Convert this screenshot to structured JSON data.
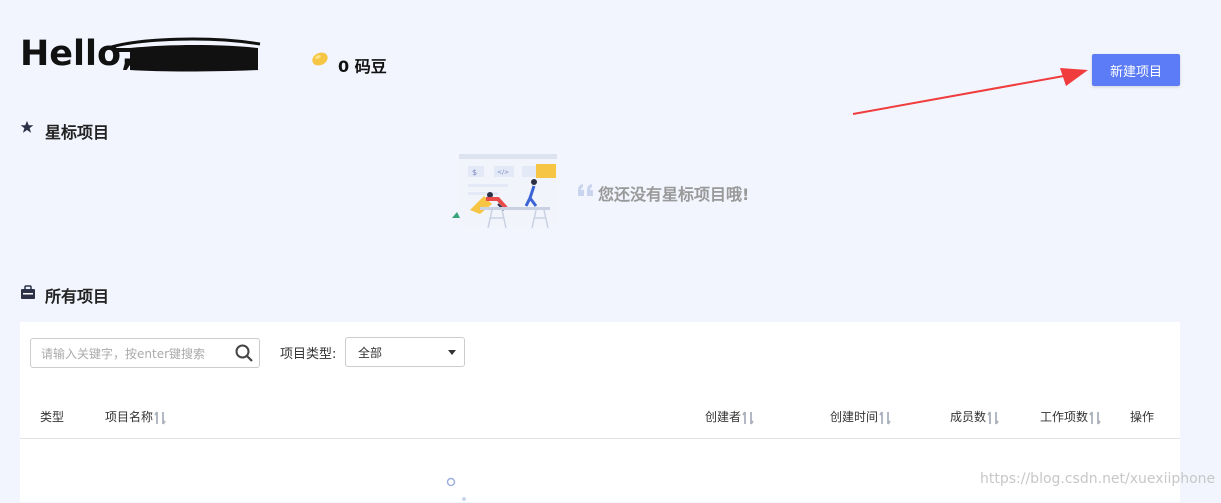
{
  "header": {
    "greeting": "Hello,",
    "coin_count": "0 码豆",
    "new_project_label": "新建项目"
  },
  "starred": {
    "title": "星标项目",
    "empty_message": "您还没有星标项目哦!"
  },
  "all_projects": {
    "title": "所有项目",
    "search_placeholder": "请输入关键字，按enter键搜索",
    "type_filter_label": "项目类型:",
    "type_filter_value": "全部",
    "columns": [
      "类型",
      "项目名称",
      "创建者",
      "创建时间",
      "成员数",
      "工作项数",
      "操作"
    ]
  },
  "watermark": "https://blog.csdn.net/xuexiiphone",
  "colors": {
    "background": "#f2f5fe",
    "primary_button": "#5b7cf6",
    "annotation_arrow": "#f03c3c",
    "coin": "#f6c543"
  },
  "icons": {
    "starred": "star-icon",
    "all_projects": "briefcase-icon",
    "search": "search-icon",
    "sort": "sort-icon",
    "coin": "coin-icon"
  }
}
